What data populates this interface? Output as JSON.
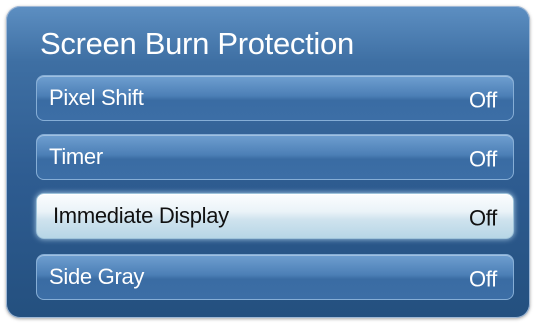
{
  "dialog": {
    "title": "Screen Burn Protection"
  },
  "menu": {
    "items": [
      {
        "label": "Pixel Shift",
        "value": "Off"
      },
      {
        "label": "Timer",
        "value": "Off"
      },
      {
        "label": "Immediate Display",
        "value": "Off"
      },
      {
        "label": "Side Gray",
        "value": "Off"
      }
    ]
  },
  "colors": {
    "panel": "#2e5c91",
    "item": "#4c7fb6",
    "selected_item": "#eaf3f8",
    "text_light": "#ffffff",
    "text_dark": "#111111"
  }
}
